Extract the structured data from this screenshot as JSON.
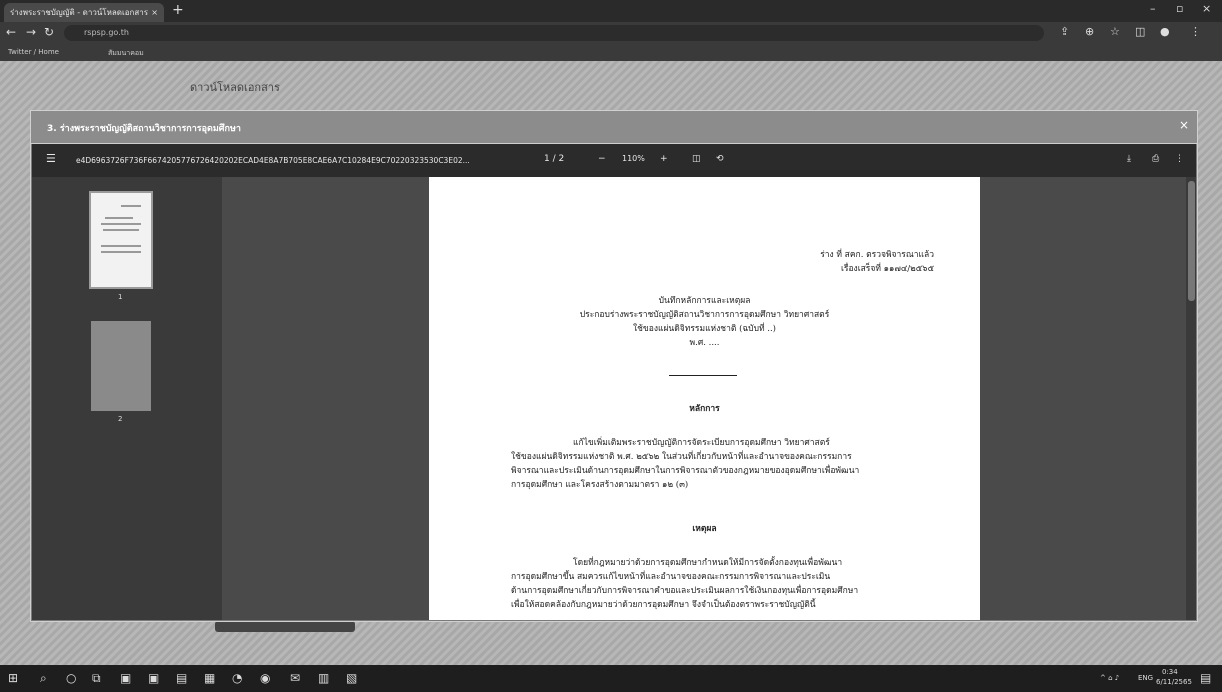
{
  "browser": {
    "tab_title": "ร่างพระราชบัญญัติ - ดาวน์โหลดเอกสาร",
    "tab_close": "×",
    "new_tab": "+",
    "address": "rspsp.go.th",
    "bookmarks": [
      "Twitter / Home",
      "สัมมนาคอม"
    ]
  },
  "page": {
    "download_heading": "ดาวน์โหลดเอกสาร"
  },
  "modal": {
    "title": "3. ร่างพระราชบัญญัติสถานวิชาการการอุดมศึกษา",
    "close": "×"
  },
  "viewer": {
    "filename": "e4D6963726F736F6674205776726420202ECAD4E8A7B705E8CAE6A7C10284E9C70220323530C3E02...",
    "page_indicator": "1 / 2",
    "zoom": "110%",
    "minus": "−",
    "plus": "+",
    "thumbnail_labels": [
      "1",
      "2"
    ]
  },
  "document": {
    "header_line1": "ร่าง ที่ สคก. ตรวจพิจารณาแล้ว",
    "header_line2": "เรื่องเสร็จที่ ๑๑๗๔/๒๕๖๕",
    "title_line1": "บันทึกหลักการและเหตุผล",
    "title_line2": "ประกอบร่างพระราชบัญญัติสถานวิชาการการอุดมศึกษา วิทยาศาสตร์",
    "title_line3": "ใช้ของแผ่นดิจิทรรมแห่งชาติ (ฉบับที่ ..)",
    "title_line4": "พ.ศ. ....",
    "principle_heading": "หลักการ",
    "principle_p1": "แก้ไขเพิ่มเติมพระราชบัญญัติการจัดระเบียบการอุดมศึกษา วิทยาศาสตร์",
    "principle_p2": "ใช้ของแผ่นดิจิทรรมแห่งชาติ พ.ศ. ๒๕๖๒ ในส่วนที่เกี่ยวกับหน้าที่และอำนาจของคณะกรรมการ",
    "principle_p3": "พิจารณาและประเมินด้านการอุดมศึกษาในการพิจารณาตัวของกฎหมายของอุดมศึกษาเพื่อพัฒนา",
    "principle_p4": "การอุดมศึกษา และโครงสร้างตามมาตรา ๑๒ (๓)",
    "reason_heading": "เหตุผล",
    "reason_p1": "โดยที่กฎหมายว่าด้วยการอุดมศึกษากำหนดให้มีการจัดตั้งกองทุนเพื่อพัฒนา",
    "reason_p2": "การอุดมศึกษาขึ้น สมควรแก้ไขหน้าที่และอำนาจของคณะกรรมการพิจารณาและประเมิน",
    "reason_p3": "ด้านการอุดมศึกษาเกี่ยวกับการพิจารณาคำขอและประเมินผลการใช้เงินกองทุนเพื่อการอุดมศึกษา",
    "reason_p4": "เพื่อให้สอดคล้องกับกฎหมายว่าด้วยการอุดมศึกษา จึงจำเป็นต้องตราพระราชบัญญัตินี้"
  },
  "taskbar": {
    "tray_text": "ENG",
    "time": "0:34",
    "date": "6/11/2565"
  }
}
